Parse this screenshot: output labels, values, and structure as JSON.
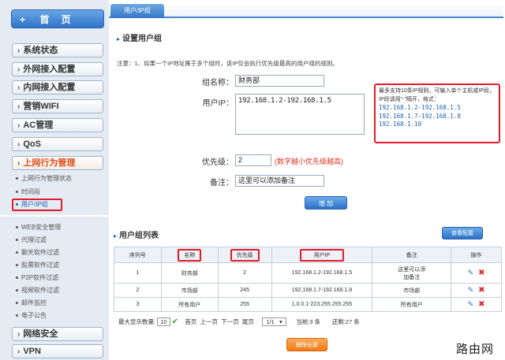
{
  "sidebar": {
    "home": "首 页",
    "menus": [
      "系统状态",
      "外网接入配置",
      "内网接入配置",
      "营销WIFI",
      "AC管理",
      "QoS",
      "上网行为管理"
    ],
    "subs_top": [
      "上网行为管理状态",
      "时间段",
      "用户/IP组"
    ],
    "subs_bottom": [
      "WEB安全管理",
      "代理过滤",
      "聊天软件过滤",
      "股票软件过滤",
      "P2P软件过滤",
      "视频软件过滤",
      "邮件监控",
      "电子公告"
    ],
    "menus_bottom": [
      "网络安全",
      "VPN"
    ]
  },
  "tab": "用户/IP组",
  "form": {
    "section_title": "设置用户组",
    "note": "注意：1、如果一个IP地址属于多个组时，该IP仅会执行优先级最高的用户组的规则。",
    "group_name_label": "组名称：",
    "group_name_value": "财务部",
    "user_ip_label": "用户IP：",
    "user_ip_value": "192.168.1.2-192.168.1.5",
    "help_text": "最多支持10条IP规则，可输入单个主机或IP段，IP段请用\"-\"隔开，格式：",
    "help_examples": [
      "192.168.1.2-192.168.1.5",
      "192.168.1.7-192.168.1.8",
      "192.168.1.10"
    ],
    "priority_label": "优先级：",
    "priority_value": "2",
    "priority_hint": "(数字越小优先级越高)",
    "remark_label": "备注：",
    "remark_value": "这里可以添加备注",
    "add_button": "增 加"
  },
  "list": {
    "section_title": "用户组列表",
    "view_button": "查看配置",
    "headers": [
      "序列号",
      "名称",
      "优先级",
      "用户IP",
      "备注",
      "操作"
    ],
    "rows": [
      {
        "id": "1",
        "name": "财务部",
        "priority": "2",
        "ip": "192.168.1.2-192.168.1.5",
        "remark_line1": "这里可以添",
        "remark_line2": "加备注"
      },
      {
        "id": "2",
        "name": "市场部",
        "priority": "245",
        "ip": "192.168.1.7-192.168.1.8",
        "remark_line1": "市场部",
        "remark_line2": ""
      },
      {
        "id": "3",
        "name": "所有用户",
        "priority": "255",
        "ip": "1.0.0.1-223.255.255.255",
        "remark_line1": "所有用户",
        "remark_line2": ""
      }
    ],
    "pager": {
      "max_label": "最大显示数量:",
      "max_value": "10",
      "first": "首页",
      "prev": "上一页",
      "next": "下一页",
      "last": "尾页",
      "page_select": "1/1",
      "current": "当前:3 条",
      "total": "还剩:27 条"
    },
    "delete_all_button": "删除全部"
  },
  "watermark": "路由网"
}
